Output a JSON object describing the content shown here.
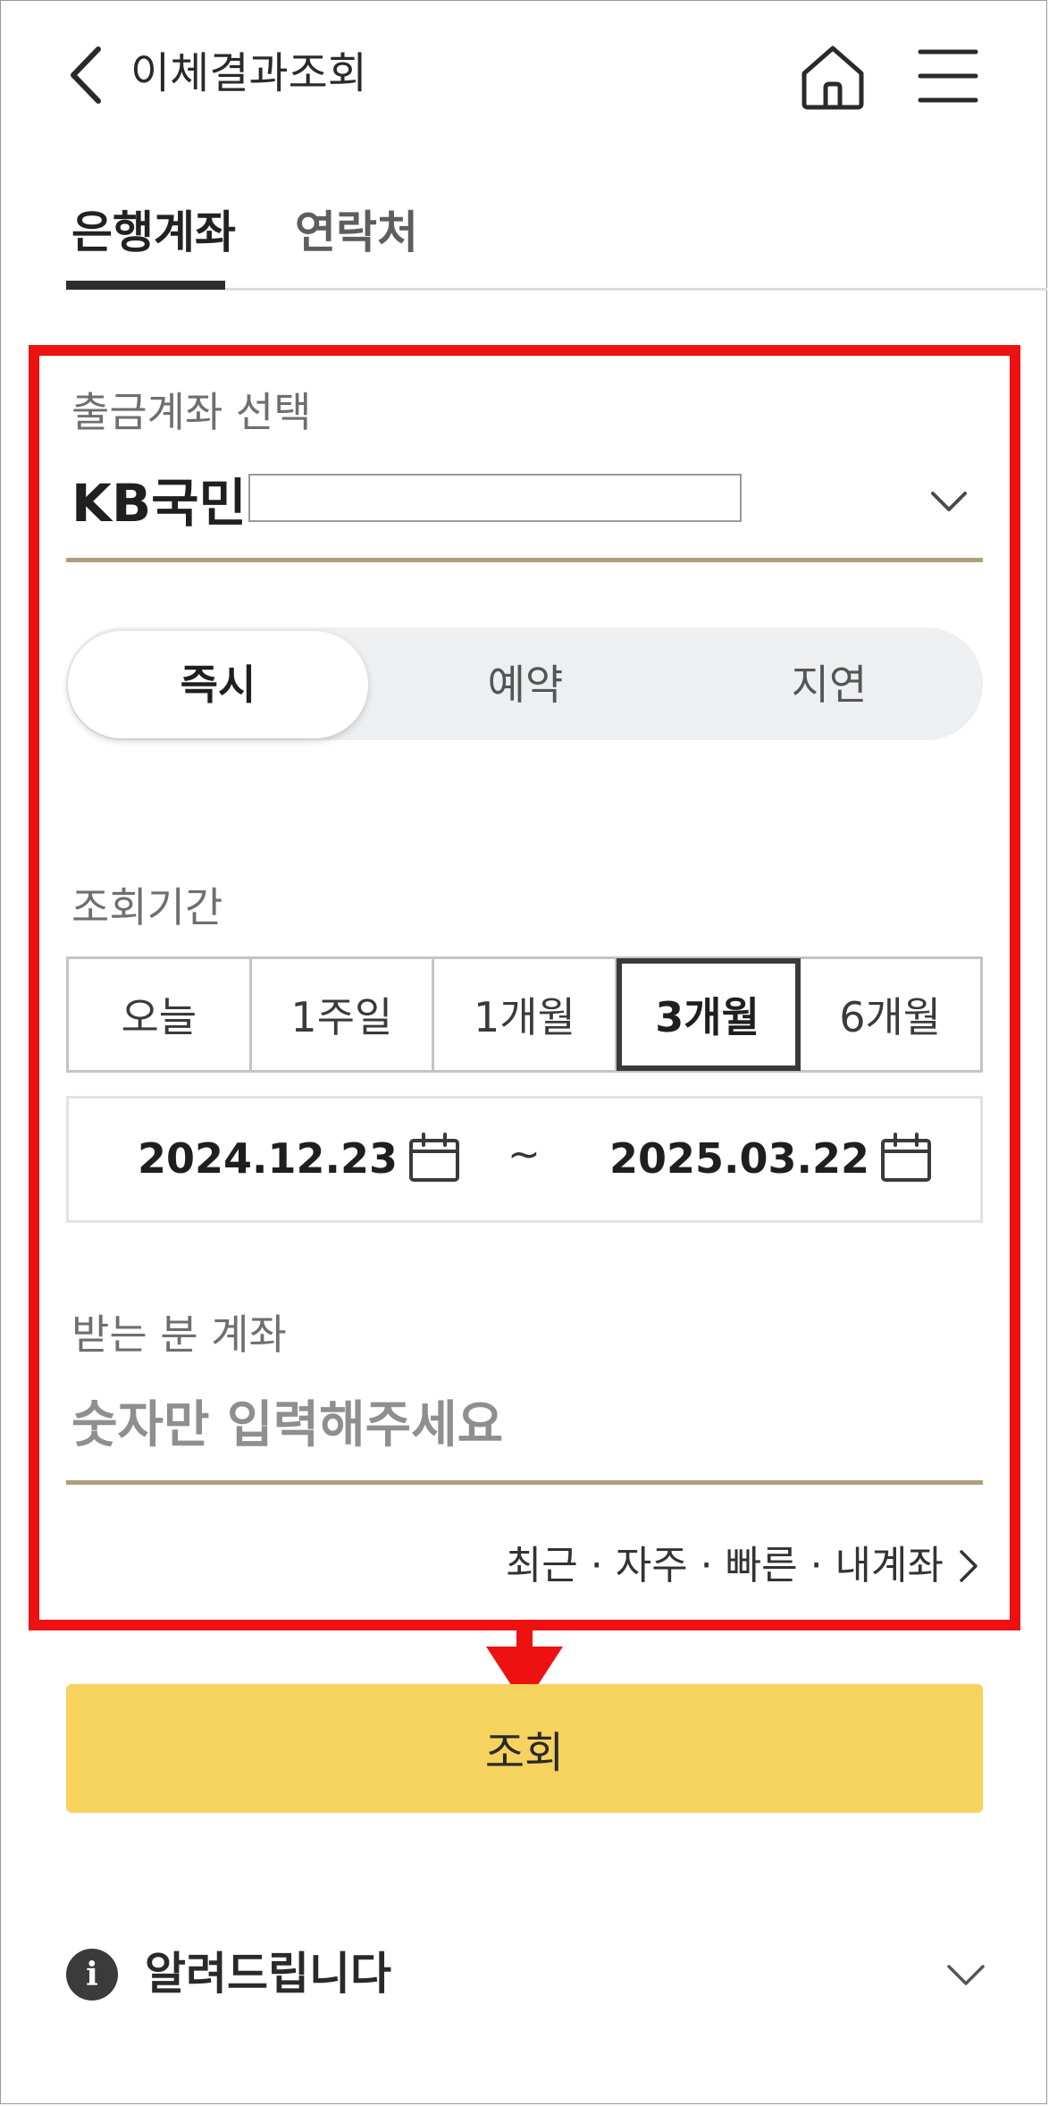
{
  "header": {
    "title": "이체결과조회"
  },
  "tabs": [
    {
      "label": "은행계좌",
      "active": true
    },
    {
      "label": "연락처",
      "active": false
    }
  ],
  "account": {
    "label": "출금계좌 선택",
    "bank": "KB국민",
    "number": ""
  },
  "transfer_type": [
    {
      "label": "즉시",
      "active": true
    },
    {
      "label": "예약",
      "active": false
    },
    {
      "label": "지연",
      "active": false
    }
  ],
  "period": {
    "label": "조회기간",
    "options": [
      {
        "label": "오늘",
        "active": false
      },
      {
        "label": "1주일",
        "active": false
      },
      {
        "label": "1개월",
        "active": false
      },
      {
        "label": "3개월",
        "active": true
      },
      {
        "label": "6개월",
        "active": false
      }
    ],
    "from": "2024.12.23",
    "separator": "~",
    "to": "2025.03.22"
  },
  "recipient": {
    "label": "받는 분 계좌",
    "placeholder": "숫자만 입력해주세요",
    "value": ""
  },
  "quick_link": {
    "label": "최근 · 자주 · 빠른 · 내계좌"
  },
  "search_button": {
    "label": "조회"
  },
  "notice": {
    "title": "알려드립니다",
    "icon": "i"
  },
  "colors": {
    "accent_yellow": "#f6d35e",
    "gold_line": "#ada07b",
    "highlight_red": "#ee1111"
  }
}
